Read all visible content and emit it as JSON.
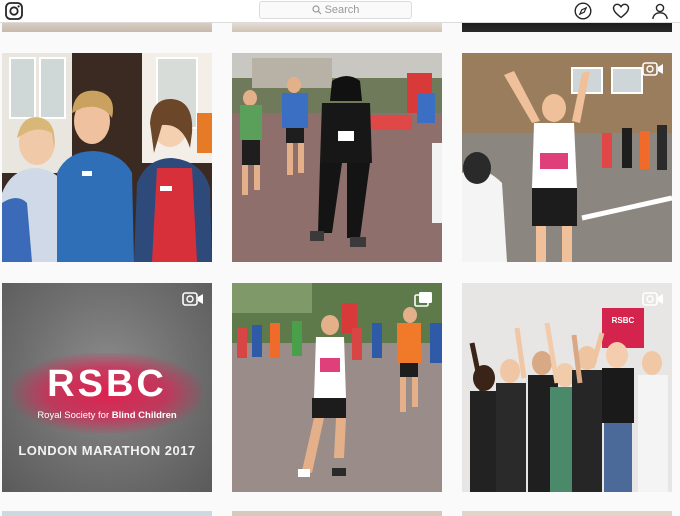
{
  "header": {
    "logo_icon": "instagram-icon",
    "search_placeholder": "Search",
    "nav_icons": [
      "compass-icon",
      "heart-icon",
      "profile-icon"
    ]
  },
  "posts": [
    {
      "type": "photo",
      "subject": "three-volunteers"
    },
    {
      "type": "photo",
      "subject": "runner-darth-vader-costume"
    },
    {
      "type": "video",
      "subject": "runner-celebrating",
      "badge_icon": "video-camera-icon"
    },
    {
      "type": "video",
      "subject": "rsbc-logo",
      "badge_icon": "video-camera-icon",
      "logo_text": "RSBC",
      "tagline_prefix": "Royal Society for",
      "tagline_bold": "Blind Children",
      "event_text": "LONDON MARATHON 2017"
    },
    {
      "type": "carousel",
      "subject": "marathon-runners",
      "badge_icon": "multiple-photos-icon"
    },
    {
      "type": "video",
      "subject": "cheering-team",
      "badge_icon": "video-camera-icon",
      "banner_text": "RSBC"
    }
  ],
  "colors": {
    "brand_pink": "#e2185b",
    "header_bg": "#ffffff",
    "page_bg": "#fafafa"
  }
}
